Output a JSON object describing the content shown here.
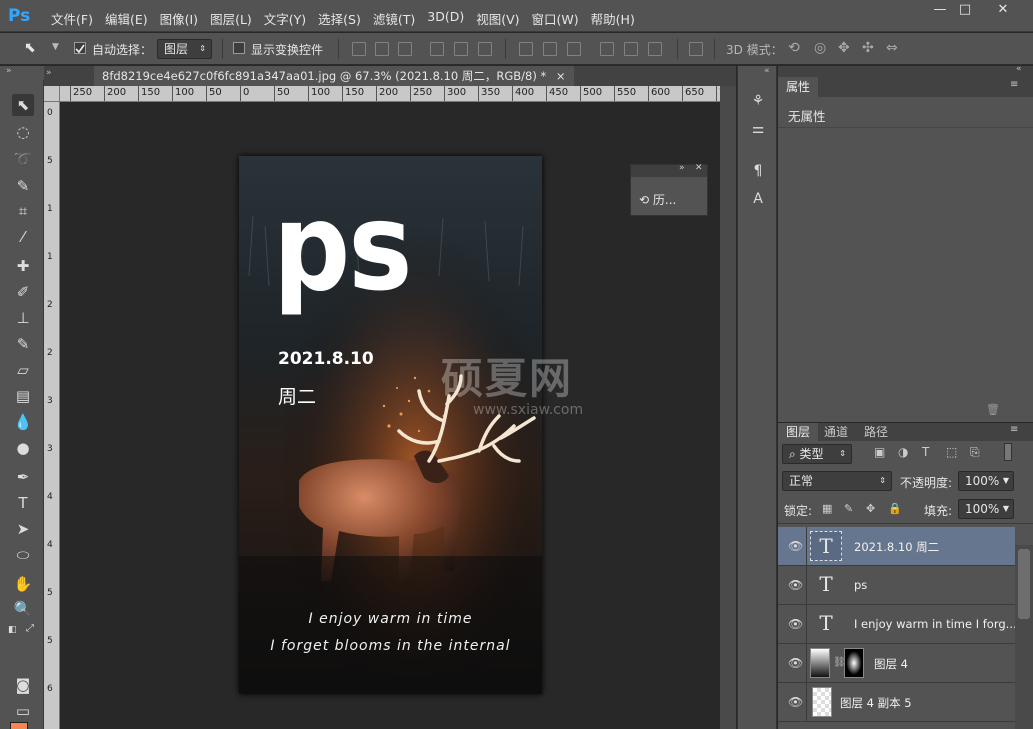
{
  "app": {
    "logo": "Ps"
  },
  "menu": [
    "文件(F)",
    "编辑(E)",
    "图像(I)",
    "图层(L)",
    "文字(Y)",
    "选择(S)",
    "滤镜(T)",
    "3D(D)",
    "视图(V)",
    "窗口(W)",
    "帮助(H)"
  ],
  "window_controls": {
    "minimize": "—",
    "maximize": "□",
    "close": "✕"
  },
  "options": {
    "auto_select_label": "自动选择：",
    "auto_select_checked": true,
    "auto_select_target": "图层",
    "show_transform_label": "显示变换控件",
    "show_transform_checked": false,
    "mode_3d_label": "3D 模式："
  },
  "document": {
    "tab_title": "8fd8219ce4e627c0f6fc891a347aa01.jpg @ 67.3% (2021.8.10 周二，RGB/8) *",
    "close": "×"
  },
  "rulers": {
    "horizontal": [
      "250",
      "200",
      "150",
      "100",
      "50",
      "0",
      "50",
      "100",
      "150",
      "200",
      "250",
      "300",
      "350",
      "400",
      "450",
      "500",
      "550",
      "600",
      "650",
      "7"
    ],
    "vertical": [
      "0",
      "5",
      "1",
      "1",
      "2",
      "2",
      "3",
      "3",
      "4",
      "4",
      "5",
      "5",
      "6"
    ]
  },
  "canvas": {
    "title": "ps",
    "date": "2021.8.10",
    "weekday": "周二",
    "line1": "I enjoy warm in time",
    "line2": "I forget blooms in the internal",
    "watermark": "硕夏网",
    "watermark_url": "www.sxiaw.com"
  },
  "history_panel": {
    "label": "历..."
  },
  "properties_panel": {
    "tab": "属性",
    "empty_text": "无属性"
  },
  "layers_panel": {
    "tabs": [
      "图层",
      "通道",
      "路径"
    ],
    "filter_label": "类型",
    "blend_mode": "正常",
    "opacity_label": "不透明度:",
    "opacity_value": "100%",
    "lock_label": "锁定:",
    "fill_label": "填充:",
    "fill_value": "100%",
    "layers": [
      {
        "name": "2021.8.10 周二",
        "type": "text",
        "selected": true
      },
      {
        "name": "ps",
        "type": "text",
        "selected": false
      },
      {
        "name": "I enjoy warm in time I forg...",
        "type": "text",
        "selected": false
      },
      {
        "name": "图层 4",
        "type": "mask",
        "selected": false
      },
      {
        "name": "图层 4 副本 5",
        "type": "pixel",
        "selected": false
      }
    ]
  },
  "colors": {
    "foreground": "#f2884e",
    "background": "#ffffff",
    "accent": "#31a8ff"
  }
}
